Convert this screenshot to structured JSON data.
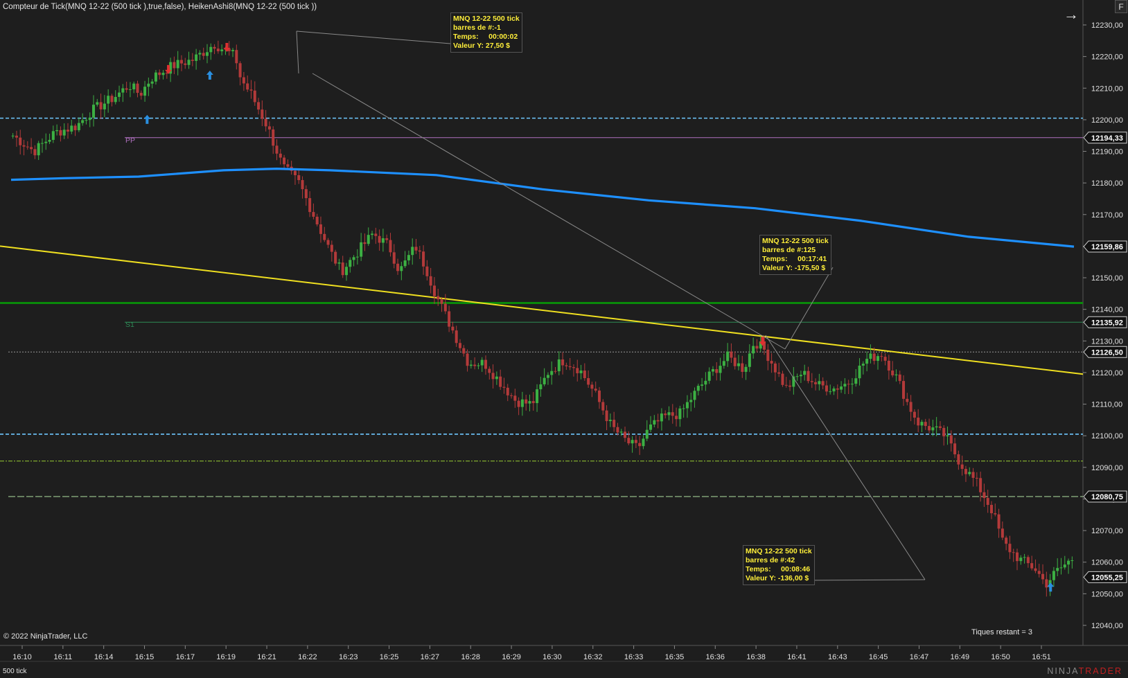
{
  "header": {
    "indicators": "Compteur de Tick(MNQ 12-22 (500 tick ),true,false), HeikenAshi8(MNQ 12-22 (500 tick ))"
  },
  "footer": {
    "copyright": "© 2022 NinjaTrader, LLC",
    "ticks_remaining": "Tiques restant = 3",
    "period": "500 tick",
    "brand_prefix": "NINJA",
    "brand_suffix": "TRADER"
  },
  "controls": {
    "f_label": "F",
    "arrow_glyph": "→"
  },
  "levels": {
    "pp": "PP",
    "s1": "S1"
  },
  "tooltips": [
    {
      "title": "MNQ 12-22 500 tick",
      "bars": "barres de #:-1",
      "time": "Temps:     00:00:02",
      "value": "Valeur Y: 27,50 $"
    },
    {
      "title": "MNQ 12-22 500 tick",
      "bars": "barres de #:125",
      "time": "Temps:     00:17:41",
      "value": "Valeur Y: -175,50 $"
    },
    {
      "title": "MNQ 12-22 500 tick",
      "bars": "barres de #:42",
      "time": "Temps:     00:08:46",
      "value": "Valeur Y: -136,00 $"
    }
  ],
  "colors": {
    "background": "#1e1e1e",
    "up_candle": "#3cb043",
    "down_candle": "#b33a3a",
    "ma": "#1e90ff",
    "trendline": "#f0e020",
    "support_green": "#0a8a0a",
    "dashed_cyan": "#6ec8ff"
  },
  "chart_data": {
    "type": "candlestick",
    "instrument": "MNQ 12-22",
    "period": "500 tick",
    "ylim": [
      12035,
      12235
    ],
    "y_ticks": [
      12040,
      12050,
      12060,
      12070,
      12080,
      12090,
      12100,
      12110,
      12120,
      12130,
      12140,
      12150,
      12160,
      12170,
      12180,
      12190,
      12200,
      12210,
      12220,
      12230
    ],
    "x_ticks": [
      "16:10",
      "16:11",
      "16:14",
      "16:15",
      "16:17",
      "16:19",
      "16:21",
      "16:22",
      "16:23",
      "16:25",
      "16:27",
      "16:28",
      "16:29",
      "16:30",
      "16:32",
      "16:33",
      "16:35",
      "16:36",
      "16:38",
      "16:41",
      "16:43",
      "16:45",
      "16:47",
      "16:49",
      "16:50",
      "16:51"
    ],
    "price_labels": [
      "12194,33",
      "12159,86",
      "12135,92",
      "12126,50",
      "12080,75",
      "12055,25"
    ],
    "horizontal_lines": [
      {
        "name": "upper-dashed",
        "value": 12200.5,
        "style": "dashed",
        "color": "#6ec8ff"
      },
      {
        "name": "PP",
        "value": 12194.33,
        "style": "solid",
        "color": "#b070c0"
      },
      {
        "name": "green-support",
        "value": 12142,
        "style": "solid",
        "color": "#0a8a0a"
      },
      {
        "name": "S1",
        "value": 12135.92,
        "style": "solid",
        "color": "#2e8b57"
      },
      {
        "name": "dotted-gray",
        "value": 12126.5,
        "style": "dotted",
        "color": "#9a9a9a"
      },
      {
        "name": "lower-dashed",
        "value": 12100.5,
        "style": "dashed",
        "color": "#6ec8ff"
      },
      {
        "name": "lime-dashdot",
        "value": 12092,
        "style": "dashdot",
        "color": "#9acd32"
      },
      {
        "name": "pale-green-dash",
        "value": 12080.75,
        "style": "longdash",
        "color": "#b0e0a0"
      }
    ],
    "ma_series": {
      "name": "ma",
      "points": [
        [
          0,
          12181
        ],
        [
          0.05,
          12181.5
        ],
        [
          0.12,
          12182
        ],
        [
          0.2,
          12184
        ],
        [
          0.25,
          12184.5
        ],
        [
          0.3,
          12184
        ],
        [
          0.4,
          12182.5
        ],
        [
          0.5,
          12178
        ],
        [
          0.6,
          12174.5
        ],
        [
          0.7,
          12172
        ],
        [
          0.8,
          12168
        ],
        [
          0.9,
          12163
        ],
        [
          1.0,
          12159.86
        ]
      ]
    },
    "trendline": {
      "from": [
        0,
        12160
      ],
      "to": [
        1,
        12119.5
      ]
    },
    "path_anchors": [
      [
        0.0,
        12195
      ],
      [
        0.02,
        12190
      ],
      [
        0.04,
        12196
      ],
      [
        0.06,
        12198
      ],
      [
        0.075,
        12203
      ],
      [
        0.095,
        12207
      ],
      [
        0.11,
        12211
      ],
      [
        0.12,
        12208
      ],
      [
        0.13,
        12213
      ],
      [
        0.15,
        12217
      ],
      [
        0.17,
        12219
      ],
      [
        0.19,
        12224
      ],
      [
        0.21,
        12220
      ],
      [
        0.215,
        12213
      ],
      [
        0.225,
        12208
      ],
      [
        0.24,
        12198
      ],
      [
        0.255,
        12185
      ],
      [
        0.27,
        12180
      ],
      [
        0.285,
        12169
      ],
      [
        0.3,
        12158
      ],
      [
        0.31,
        12152
      ],
      [
        0.325,
        12158
      ],
      [
        0.34,
        12164
      ],
      [
        0.355,
        12160
      ],
      [
        0.365,
        12152
      ],
      [
        0.38,
        12160
      ],
      [
        0.39,
        12153
      ],
      [
        0.4,
        12144
      ],
      [
        0.41,
        12137
      ],
      [
        0.42,
        12130
      ],
      [
        0.43,
        12123
      ],
      [
        0.445,
        12123
      ],
      [
        0.46,
        12117
      ],
      [
        0.475,
        12111
      ],
      [
        0.49,
        12110
      ],
      [
        0.505,
        12120
      ],
      [
        0.52,
        12124
      ],
      [
        0.535,
        12121
      ],
      [
        0.55,
        12113
      ],
      [
        0.565,
        12103
      ],
      [
        0.58,
        12098
      ],
      [
        0.59,
        12096
      ],
      [
        0.6,
        12102
      ],
      [
        0.615,
        12106
      ],
      [
        0.63,
        12107
      ],
      [
        0.645,
        12114
      ],
      [
        0.66,
        12120
      ],
      [
        0.675,
        12125
      ],
      [
        0.69,
        12121
      ],
      [
        0.7,
        12130
      ],
      [
        0.71,
        12127
      ],
      [
        0.72,
        12121
      ],
      [
        0.73,
        12115
      ],
      [
        0.745,
        12120
      ],
      [
        0.76,
        12116
      ],
      [
        0.775,
        12115
      ],
      [
        0.79,
        12117
      ],
      [
        0.805,
        12124
      ],
      [
        0.82,
        12126
      ],
      [
        0.835,
        12118
      ],
      [
        0.845,
        12110
      ],
      [
        0.855,
        12104
      ],
      [
        0.87,
        12102
      ],
      [
        0.88,
        12100
      ],
      [
        0.895,
        12091
      ],
      [
        0.91,
        12085
      ],
      [
        0.925,
        12076
      ],
      [
        0.935,
        12066
      ],
      [
        0.95,
        12061
      ],
      [
        0.965,
        12058
      ],
      [
        0.975,
        12053
      ],
      [
        0.985,
        12057
      ],
      [
        1.0,
        12061
      ]
    ],
    "candle_count": 290,
    "signal_markers": [
      {
        "dir": "up",
        "bar_frac": 0.128,
        "value": 12200
      },
      {
        "dir": "down",
        "bar_frac": 0.148,
        "value": 12216
      },
      {
        "dir": "up",
        "bar_frac": 0.187,
        "value": 12214
      },
      {
        "dir": "down",
        "bar_frac": 0.203,
        "value": 12223
      },
      {
        "dir": "down",
        "bar_frac": 0.707,
        "value": 12130
      },
      {
        "dir": "up",
        "bar_frac": 0.978,
        "value": 12052
      }
    ]
  }
}
